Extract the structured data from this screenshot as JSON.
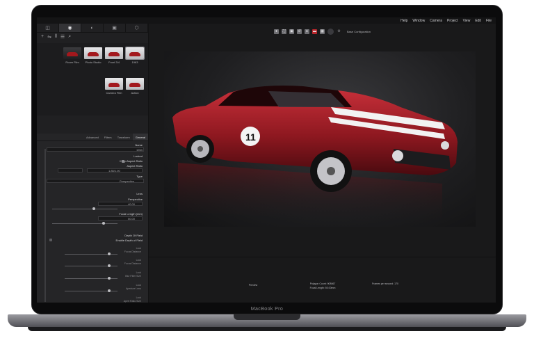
{
  "device": {
    "label": "MacBook Pro"
  },
  "colors": {
    "accent_red": "#b9272c",
    "car_red": "#a3181d",
    "background": "#1d1d1f"
  },
  "menubar": {
    "items": [
      "Help",
      "Window",
      "Camera",
      "Project",
      "View",
      "Edit",
      "File"
    ]
  },
  "sidebar": {
    "tabs": [
      {
        "icon": "panels-icon",
        "glyph": "◫"
      },
      {
        "icon": "camera-icon",
        "glyph": "◉"
      },
      {
        "icon": "palette-icon",
        "glyph": "◐"
      },
      {
        "icon": "library-icon",
        "glyph": "▣"
      },
      {
        "icon": "cube-icon",
        "glyph": "⬡"
      }
    ],
    "tools": [
      {
        "icon": "add-icon",
        "glyph": "+"
      },
      {
        "icon": "sync-icon",
        "glyph": "⇋"
      },
      {
        "icon": "columns-icon",
        "glyph": "⫴"
      },
      {
        "icon": "list-icon",
        "glyph": "☰"
      },
      {
        "icon": "search-icon",
        "glyph": "⌕"
      }
    ],
    "cameras": [
      {
        "label": "1963",
        "dark": false
      },
      {
        "label": "Front 3/4",
        "dark": false
      },
      {
        "label": "Photo Studio",
        "dark": false
      },
      {
        "label": "Room Film",
        "dark": true
      },
      {
        "label": "Action",
        "dark": false
      },
      {
        "label": "Camera Film",
        "dark": false
      }
    ],
    "props_tabs": [
      "General",
      "Transform",
      "Filters",
      "Advanced"
    ],
    "props": {
      "name_label": "Name",
      "name_value": "1963",
      "locked_label": "Locked",
      "keep_aspect": "Keep Aspect Ratio",
      "aspect_label": "Aspect Ratio",
      "aspect_value": "1.85/1.00",
      "type_label": "Type",
      "type_value": "Perspective",
      "lens_label": "Lens",
      "perspective_label": "Perspective",
      "perspective_value": "40.00",
      "focal_label": "Focal Length (mm)",
      "focal_value": "50.00",
      "dof_label": "Depth Of Field",
      "enable_dof": "Enable Depth of Field",
      "dof_rows": [
        "Lock",
        "Focus Distance",
        "Lock",
        "Focus Distance",
        "Lock",
        "Blur Filter Size",
        "Lock",
        "Aperture Lens",
        "Lock",
        "Apert Ratio Size"
      ]
    }
  },
  "viewport": {
    "toolbar_icons": [
      {
        "icon": "render-icon",
        "glyph": "●"
      },
      {
        "icon": "fullscreen-icon",
        "glyph": "⛶"
      },
      {
        "icon": "snapshot-icon",
        "glyph": "▣"
      },
      {
        "icon": "reset-icon",
        "glyph": "↺"
      },
      {
        "icon": "tree-icon",
        "glyph": "♠"
      },
      {
        "icon": "screen-icon",
        "glyph": "▬"
      },
      {
        "icon": "gallery-icon",
        "glyph": "▦"
      },
      {
        "icon": "sphere-icon",
        "glyph": ""
      },
      {
        "icon": "settings-icon",
        "glyph": "⚙"
      }
    ],
    "config_label": "Base Configuration",
    "status": {
      "frames": "Frames per second: 170",
      "polygons": "Polygon Count: 908067",
      "focal": "Focal Length: 50.00mm",
      "preview": "Preview"
    }
  }
}
